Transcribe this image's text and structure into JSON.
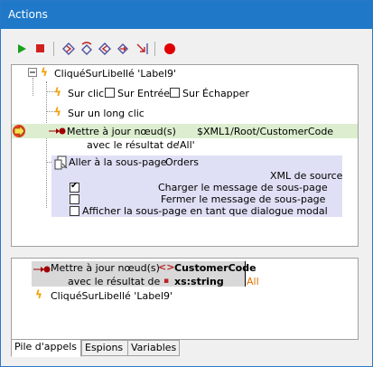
{
  "window": {
    "title": "Actions"
  },
  "toolbar": {
    "buttons": [
      {
        "icon": "play-icon",
        "color": "#1aa01a"
      },
      {
        "icon": "stop-icon",
        "color": "#d02020"
      },
      {
        "icon": "step-into-icon"
      },
      {
        "icon": "step-over-icon"
      },
      {
        "icon": "step-out-icon"
      },
      {
        "icon": "step-next-icon"
      },
      {
        "icon": "step-to-end-icon"
      },
      {
        "icon": "breakpoint-icon",
        "color": "#e00000"
      }
    ]
  },
  "actions_tree": {
    "root_label": "CliquéSurLibellé 'Label9'",
    "on_click": {
      "label": "Sur clic",
      "cb1_label": "Sur Entrée",
      "cb2_label": "Sur Échapper"
    },
    "on_long_click": {
      "label": "Sur un long clic"
    },
    "update_node": {
      "prefix": "Mettre à jour nœud(s)",
      "target": "$XML1/Root/CustomerCode",
      "result_label": "avec le résultat de",
      "result_value": "'All'"
    },
    "goto_page": {
      "label": "Aller à la sous-page",
      "page": "Orders",
      "xml_source": "XML de source",
      "options": [
        {
          "label": "Charger le message de sous-page",
          "checked": true
        },
        {
          "label": "Fermer le message de sous-page",
          "checked": false
        },
        {
          "label": "Afficher la sous-page en tant que dialogue modal",
          "checked": false
        }
      ]
    }
  },
  "call_stack": {
    "row1_label": "Mettre à jour nœud(s)",
    "row1_value": "CustomerCode",
    "row2_label": "avec le résultat de",
    "row2_value": "xs:string",
    "row2_extra": "All",
    "row3_label": "CliquéSurLibellé 'Label9'"
  },
  "tabs": [
    {
      "label": "Pile d'appels",
      "active": true
    },
    {
      "label": "Espions",
      "active": false
    },
    {
      "label": "Variables",
      "active": false
    }
  ]
}
